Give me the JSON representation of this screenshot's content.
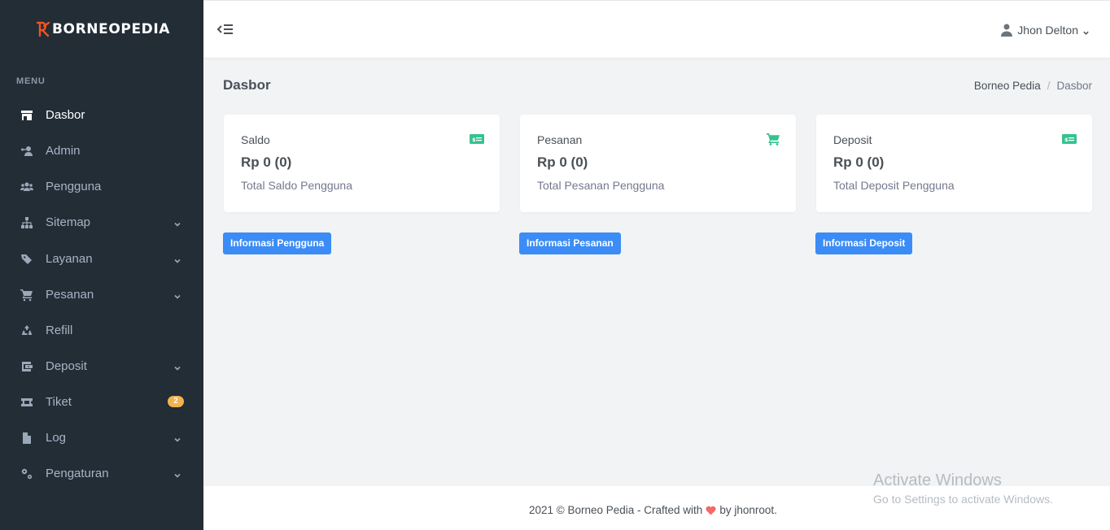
{
  "app": {
    "brand_name": "BORNEOPEDIA"
  },
  "sidebar": {
    "menu_title": "MENU",
    "items": [
      {
        "label": "Dasbor",
        "icon": "storefront-icon",
        "active": true
      },
      {
        "label": "Admin",
        "icon": "user-key-icon"
      },
      {
        "label": "Pengguna",
        "icon": "users-icon"
      },
      {
        "label": "Sitemap",
        "icon": "sitemap-icon",
        "expandable": true
      },
      {
        "label": "Layanan",
        "icon": "tags-icon",
        "expandable": true
      },
      {
        "label": "Pesanan",
        "icon": "cart-icon",
        "expandable": true
      },
      {
        "label": "Refill",
        "icon": "recycle-icon"
      },
      {
        "label": "Deposit",
        "icon": "wallet-icon",
        "expandable": true
      },
      {
        "label": "Tiket",
        "icon": "ticket-icon",
        "badge": "2"
      },
      {
        "label": "Log",
        "icon": "file-icon",
        "expandable": true
      },
      {
        "label": "Pengaturan",
        "icon": "cogs-icon",
        "expandable": true
      }
    ]
  },
  "header": {
    "user_name": "Jhon Delton"
  },
  "page": {
    "title": "Dasbor",
    "breadcrumb": {
      "parent": "Borneo Pedia",
      "separator": "/",
      "current": "Dasbor"
    }
  },
  "cards": [
    {
      "label": "Saldo",
      "value": "Rp 0 (0)",
      "desc": "Total Saldo Pengguna",
      "icon": "money-icon",
      "button": "Informasi Pengguna"
    },
    {
      "label": "Pesanan",
      "value": "Rp 0 (0)",
      "desc": "Total Pesanan Pengguna",
      "icon": "cart-icon",
      "button": "Informasi Pesanan"
    },
    {
      "label": "Deposit",
      "value": "Rp 0 (0)",
      "desc": "Total Deposit Pengguna",
      "icon": "money-icon",
      "button": "Informasi Deposit"
    }
  ],
  "footer": {
    "text_before": "2021 © Borneo Pedia - Crafted with",
    "text_after": "by jhonroot."
  },
  "watermark": {
    "title": "Activate Windows",
    "subtitle": "Go to Settings to activate Windows."
  },
  "colors": {
    "sidebar_bg": "#222d36",
    "primary": "#3b8cf7",
    "success": "#34c38f",
    "warning": "#f1b44c",
    "danger": "#f46a6a"
  }
}
